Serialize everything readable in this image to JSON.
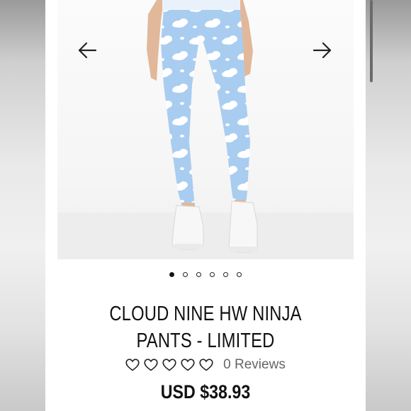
{
  "image_alt": "Cloud print leggings",
  "gallery": {
    "total_slides": 6,
    "active_index": 0,
    "prev_icon": "arrow-left-icon",
    "next_icon": "arrow-right-icon"
  },
  "product": {
    "title": "CLOUD NINE HW NINJA PANTS - LIMITED",
    "rating_icons": [
      "heart-icon",
      "heart-icon",
      "heart-icon",
      "heart-icon",
      "heart-icon"
    ],
    "reviews_label": "0 Reviews",
    "price": "USD $38.93"
  },
  "colors": {
    "legging_blue": "#a9cdf0",
    "cloud_white": "#ffffff"
  }
}
